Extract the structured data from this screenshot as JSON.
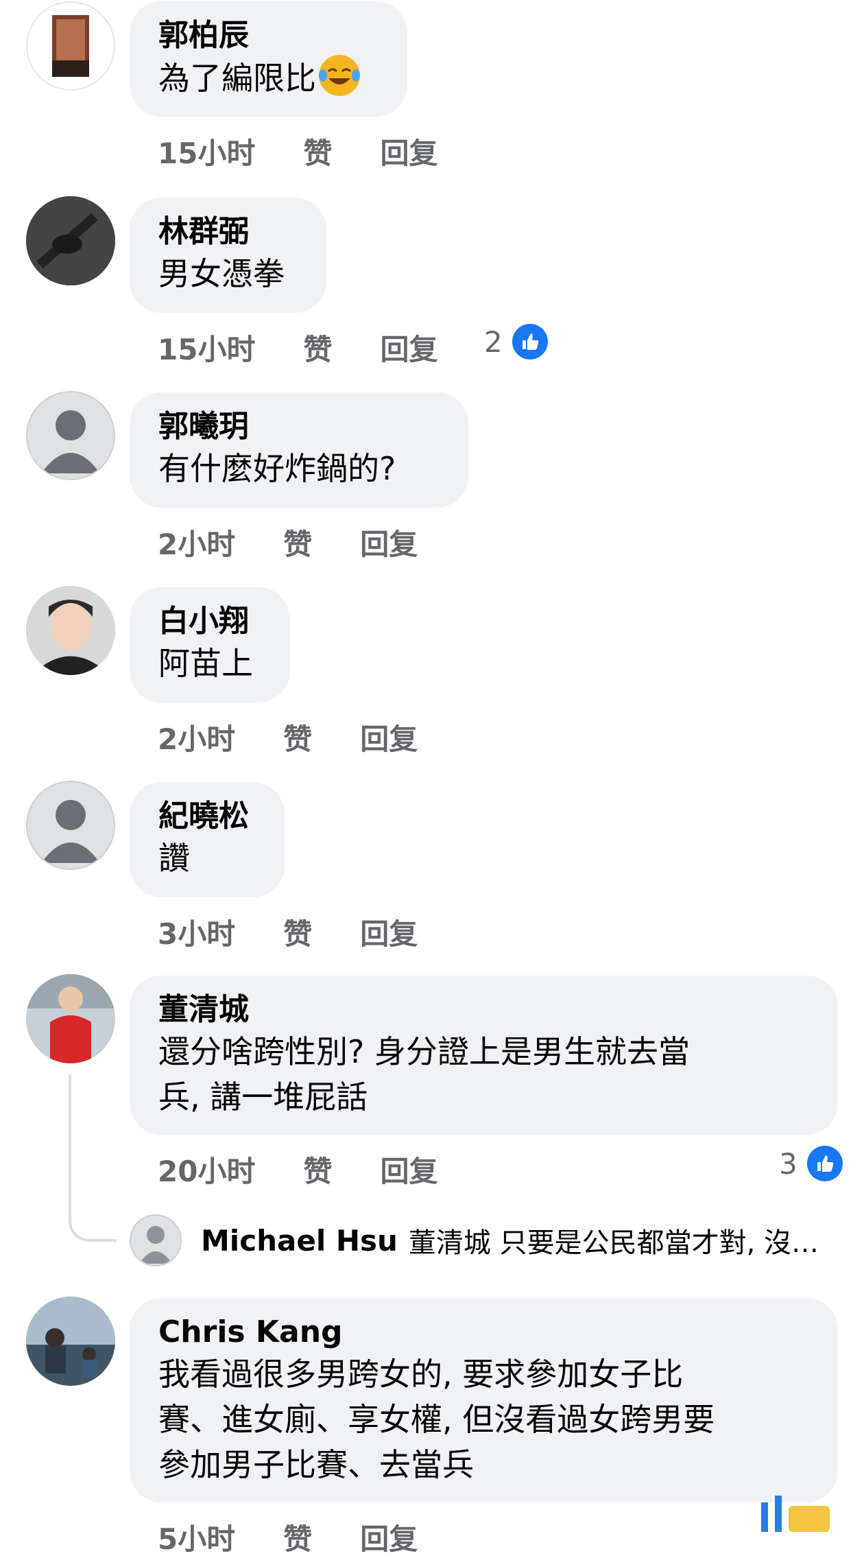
{
  "comments": [
    {
      "author": "郭柏辰",
      "text": "為了編限比",
      "emoji": "joy-tears-emoji",
      "time": "15小时",
      "like": "赞",
      "reply": "回复",
      "count": ""
    },
    {
      "author": "林群弼",
      "text": "男女憑拳",
      "time": "15小时",
      "like": "赞",
      "reply": "回复",
      "count": "2"
    },
    {
      "author": "郭曦玥",
      "text": "有什麼好炸鍋的?",
      "time": "2小时",
      "like": "赞",
      "reply": "回复",
      "count": ""
    },
    {
      "author": "白小翔",
      "text": "阿苗上",
      "time": "2小时",
      "like": "赞",
      "reply": "回复",
      "count": ""
    },
    {
      "author": "紀曉松",
      "text": "讚",
      "time": "3小时",
      "like": "赞",
      "reply": "回复",
      "count": ""
    },
    {
      "author": "董清城",
      "text_l1": "還分啥跨性別? 身分證上是男生就去當",
      "text_l2": "兵, 講一堆屁話",
      "time": "20小时",
      "like": "赞",
      "reply": "回复",
      "count": "3"
    },
    {
      "author": "Chris Kang",
      "text_l1": "我看過很多男跨女的, 要求參加女子比",
      "text_l2": "賽、進女廁、享女權, 但沒看過女跨男要",
      "text_l3": "參加男子比賽、去當兵",
      "time": "5小时",
      "like": "赞",
      "reply": "回复",
      "count": ""
    }
  ],
  "reply_preview": {
    "author": "Michael Hsu",
    "text": "董清城 只要是公民都當才對, 沒…"
  },
  "colors": {
    "bubble": "#f0f2f5",
    "meta": "#65676b",
    "like_blue": "#1877f2"
  }
}
